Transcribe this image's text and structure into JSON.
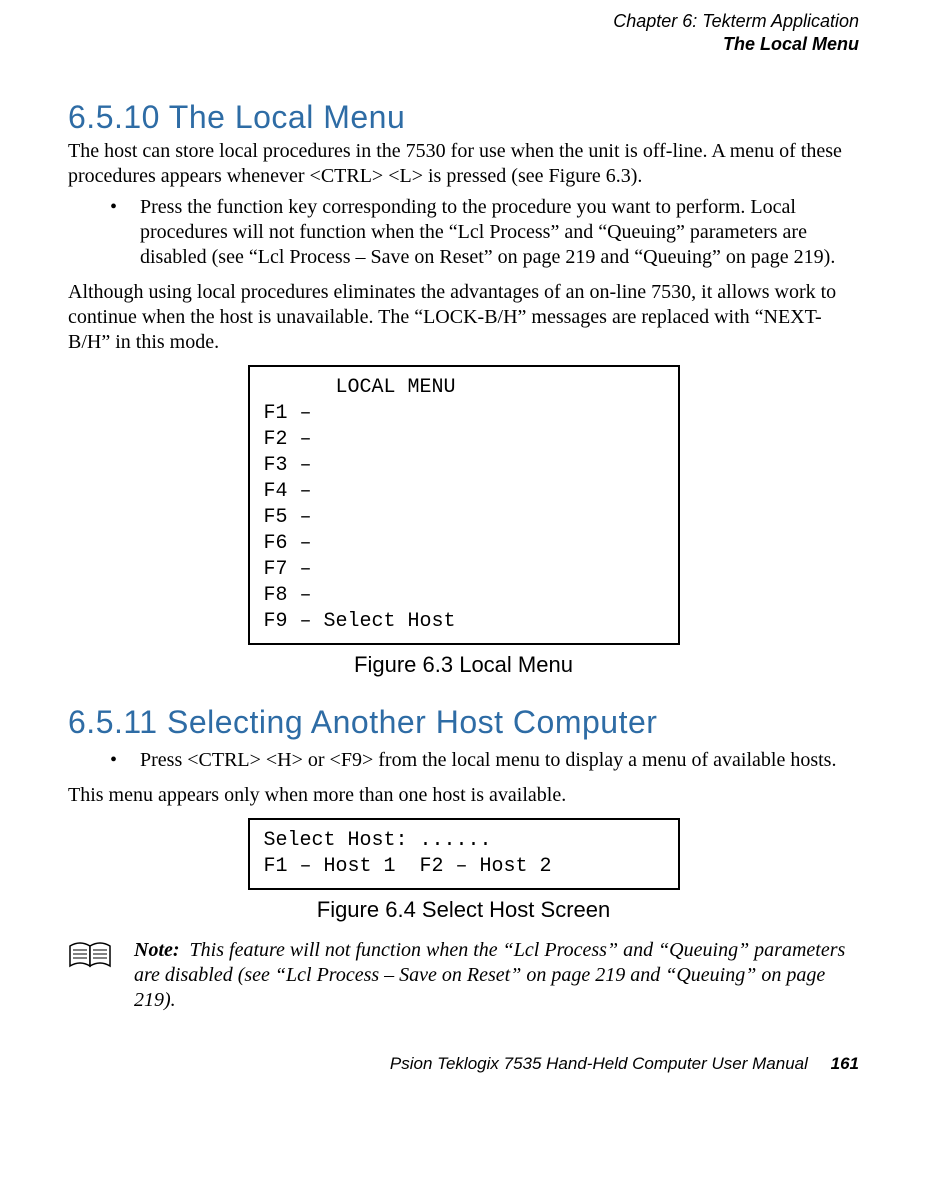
{
  "running_head": {
    "chapter": "Chapter 6: Tekterm Application",
    "section": "The Local Menu"
  },
  "sec_6_5_10": {
    "heading": "6.5.10  The Local Menu",
    "para1": "The host can store local procedures in the 7530 for use when the unit is off-line. A menu of these procedures appears whenever  <CTRL> <L> is pressed (see Figure 6.3).",
    "bullet1": "Press the function key corresponding to the procedure you want to perform. Local procedures will not function when the “Lcl Process” and “Queuing” parameters are disabled (see “Lcl Process – Save on Reset” on page 219 and “Queuing” on page 219).",
    "para2": "Although using local procedures eliminates the advantages of an on-line 7530, it allows work to continue when the host is unavailable. The “LOCK-B/H” messages are replaced with “NEXT-B/H” in this mode."
  },
  "figure_6_3": {
    "content": "      LOCAL MENU\nF1 –\nF2 –\nF3 –\nF4 –\nF5 –\nF6 –\nF7 –\nF8 –\nF9 – Select Host",
    "caption": "Figure 6.3 Local Menu"
  },
  "sec_6_5_11": {
    "heading": "6.5.11  Selecting Another Host Computer",
    "bullet1": "Press  <CTRL> <H> or <F9> from the local menu to display a menu of available hosts.",
    "para1": "This menu appears only when more than one host is available."
  },
  "figure_6_4": {
    "content": "Select Host: ......\nF1 – Host 1  F2 – Host 2\n",
    "caption": "Figure 6.4 Select Host Screen"
  },
  "note": {
    "label": "Note:",
    "text": "This feature will not function when the “Lcl Process” and “Queuing” parameters are disabled (see “Lcl Process – Save on Reset” on page 219 and “Queuing” on page 219)."
  },
  "footer": {
    "title": "Psion Teklogix 7535 Hand-Held Computer User Manual",
    "page": "161"
  }
}
